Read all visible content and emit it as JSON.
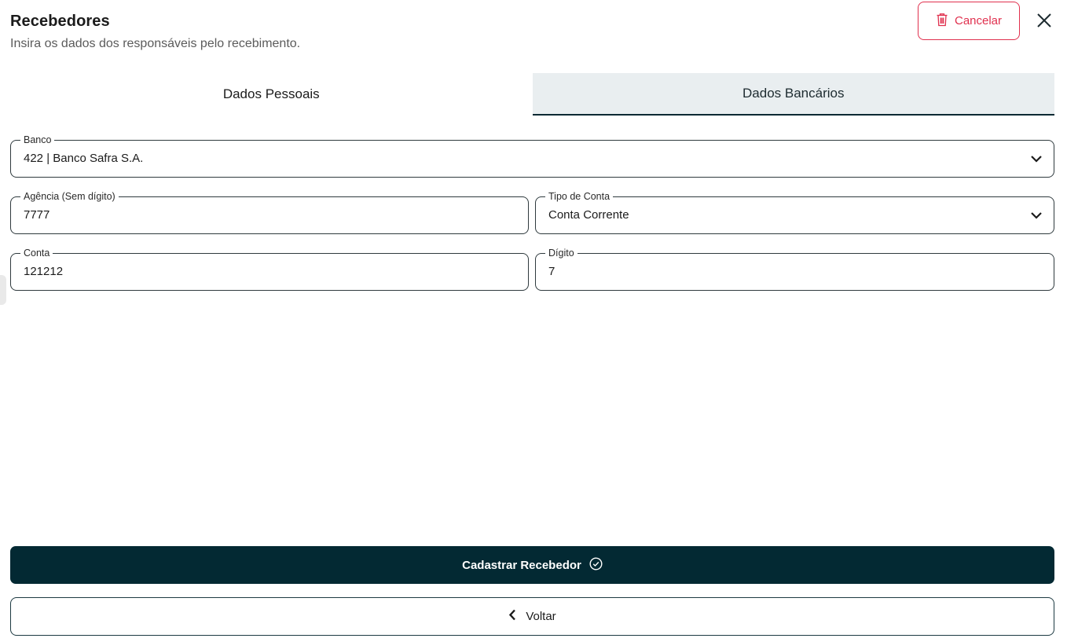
{
  "header": {
    "title": "Recebedores",
    "subtitle": "Insira os dados dos responsáveis pelo recebimento."
  },
  "actions": {
    "cancel_label": "Cancelar",
    "close_icon": "close-icon",
    "trash_icon": "trash-icon"
  },
  "tabs": [
    {
      "label": "Dados Pessoais",
      "active": false
    },
    {
      "label": "Dados Bancários",
      "active": true
    }
  ],
  "form": {
    "banco": {
      "label": "Banco",
      "value": "422 | Banco Safra S.A."
    },
    "agencia": {
      "label": "Agência (Sem dígito)",
      "value": "7777"
    },
    "tipo_conta": {
      "label": "Tipo de Conta",
      "value": "Conta Corrente"
    },
    "conta": {
      "label": "Conta",
      "value": "121212"
    },
    "digito": {
      "label": "Dígito",
      "value": "7"
    }
  },
  "footer": {
    "submit_label": "Cadastrar Recebedor",
    "back_label": "Voltar"
  },
  "colors": {
    "primary": "#032933",
    "danger": "#e0304e",
    "tab_active_bg": "#e9eef0"
  }
}
